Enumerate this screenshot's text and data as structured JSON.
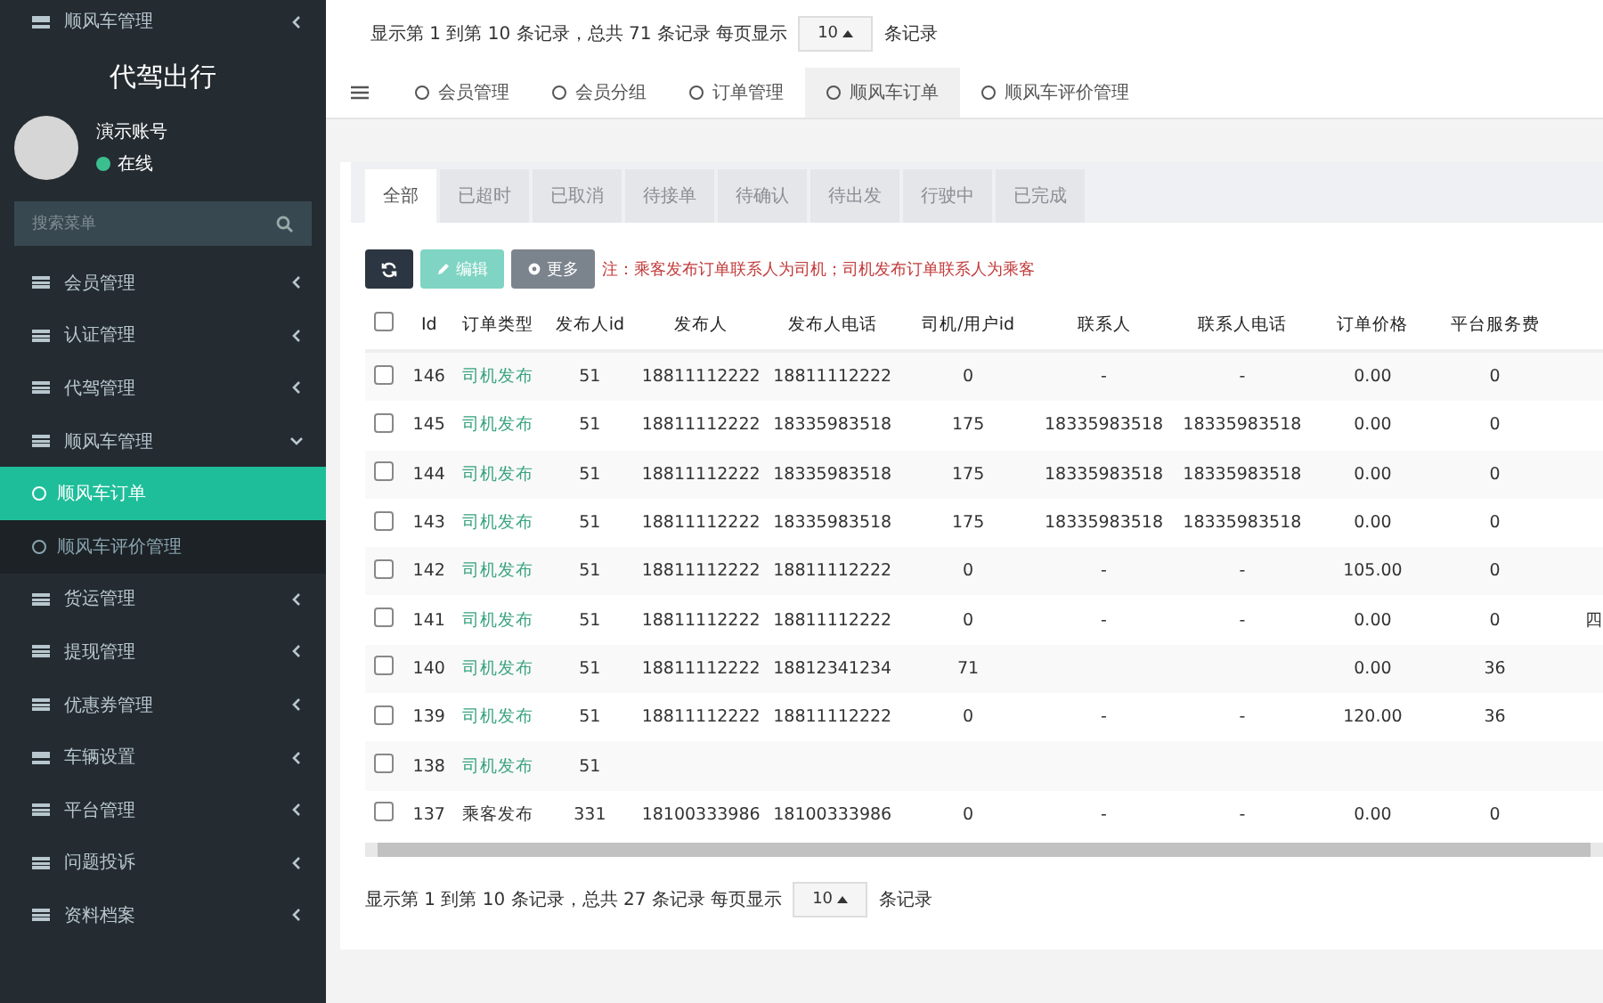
{
  "sidebar": {
    "ghost_item": "顺风车管理",
    "brand": "代驾出行",
    "user": {
      "name": "演示账号",
      "status": "在线"
    },
    "search": {
      "placeholder": "搜索菜单"
    },
    "items": [
      {
        "label": "会员管理",
        "expanded": false
      },
      {
        "label": "认证管理",
        "expanded": false
      },
      {
        "label": "代驾管理",
        "expanded": false
      },
      {
        "label": "顺风车管理",
        "expanded": true,
        "children": [
          {
            "label": "顺风车订单",
            "selected": true
          },
          {
            "label": "顺风车评价管理",
            "selected": false
          }
        ]
      },
      {
        "label": "货运管理",
        "expanded": false
      },
      {
        "label": "提现管理",
        "expanded": false
      },
      {
        "label": "优惠券管理",
        "expanded": false
      },
      {
        "label": "车辆设置",
        "expanded": false
      },
      {
        "label": "平台管理",
        "expanded": false
      },
      {
        "label": "问题投诉",
        "expanded": false
      },
      {
        "label": "资料档案",
        "expanded": false
      }
    ]
  },
  "ghost_pagination": {
    "before": "显示第 1 到第 10 条记录，总共 71 条记录 每页显示",
    "page_size": "10",
    "after": "条记录"
  },
  "nav_tabs": [
    {
      "label": "会员管理",
      "selected": false
    },
    {
      "label": "会员分组",
      "selected": false
    },
    {
      "label": "订单管理",
      "selected": false
    },
    {
      "label": "顺风车订单",
      "selected": true
    },
    {
      "label": "顺风车评价管理",
      "selected": false
    }
  ],
  "status_tabs": [
    {
      "label": "全部",
      "selected": true
    },
    {
      "label": "已超时",
      "selected": false
    },
    {
      "label": "已取消",
      "selected": false
    },
    {
      "label": "待接单",
      "selected": false
    },
    {
      "label": "待确认",
      "selected": false
    },
    {
      "label": "待出发",
      "selected": false
    },
    {
      "label": "行驶中",
      "selected": false
    },
    {
      "label": "已完成",
      "selected": false
    }
  ],
  "toolbar": {
    "edit": "编辑",
    "more": "更多",
    "note": "注：乘客发布订单联系人为司机；司机发布订单联系人为乘客"
  },
  "table": {
    "select_all_checked": false,
    "columns": [
      "Id",
      "订单类型",
      "发布人id",
      "发布人",
      "发布人电话",
      "司机/用户id",
      "联系人",
      "联系人电话",
      "订单价格",
      "平台服务费"
    ],
    "rows": [
      {
        "kind": "driver",
        "checked": false,
        "cells": [
          "146",
          "司机发布",
          "51",
          "18811112222",
          "18811112222",
          "0",
          "-",
          "-",
          "0.00",
          "0"
        ]
      },
      {
        "kind": "driver",
        "checked": false,
        "cells": [
          "145",
          "司机发布",
          "51",
          "18811112222",
          "18335983518",
          "175",
          "18335983518",
          "18335983518",
          "0.00",
          "0"
        ]
      },
      {
        "kind": "driver",
        "checked": false,
        "cells": [
          "144",
          "司机发布",
          "51",
          "18811112222",
          "18335983518",
          "175",
          "18335983518",
          "18335983518",
          "0.00",
          "0"
        ]
      },
      {
        "kind": "driver",
        "checked": false,
        "cells": [
          "143",
          "司机发布",
          "51",
          "18811112222",
          "18335983518",
          "175",
          "18335983518",
          "18335983518",
          "0.00",
          "0"
        ]
      },
      {
        "kind": "driver",
        "checked": false,
        "cells": [
          "142",
          "司机发布",
          "51",
          "18811112222",
          "18811112222",
          "0",
          "-",
          "-",
          "105.00",
          "0"
        ]
      },
      {
        "kind": "driver",
        "checked": false,
        "cells": [
          "141",
          "司机发布",
          "51",
          "18811112222",
          "18811112222",
          "0",
          "-",
          "-",
          "0.00",
          "0"
        ],
        "column_11": "四"
      },
      {
        "kind": "driver",
        "checked": false,
        "cells": [
          "140",
          "司机发布",
          "51",
          "18811112222",
          "18812341234",
          "71",
          "",
          "",
          "0.00",
          "36"
        ]
      },
      {
        "kind": "driver",
        "checked": false,
        "cells": [
          "139",
          "司机发布",
          "51",
          "18811112222",
          "18811112222",
          "0",
          "-",
          "-",
          "120.00",
          "36"
        ]
      },
      {
        "kind": "driver",
        "checked": false,
        "cells": [
          "138",
          "司机发布",
          "51",
          "",
          "",
          "",
          "",
          "",
          "",
          ""
        ]
      },
      {
        "kind": "passenger",
        "checked": false,
        "cells": [
          "137",
          "乘客发布",
          "331",
          "18100333986",
          "18100333986",
          "0",
          "-",
          "-",
          "0.00",
          "0"
        ]
      }
    ]
  },
  "pagination": {
    "before": "显示第 1 到第 10 条记录，总共 27 条记录 每页显示",
    "page_size": "10",
    "after": "条记录"
  }
}
